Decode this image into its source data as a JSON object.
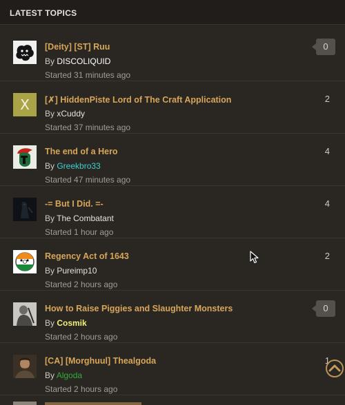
{
  "header": {
    "title": "LATEST TOPICS"
  },
  "topics": [
    {
      "title": "[Deity] [ST] Ruu",
      "by": "By ",
      "author": "DISCOLIQUID",
      "author_color": "#ffffff",
      "started": "Started 31 minutes ago",
      "count": "0",
      "bubble": true,
      "avatar": "ink-blot-avatar"
    },
    {
      "title": "[✗] HiddenPiste Lord of The Craft Application",
      "by": "By ",
      "author": "xCuddy",
      "author_color": "#e6e1da",
      "started": "Started 37 minutes ago",
      "count": "2",
      "bubble": false,
      "avatar": "letter-x-avatar",
      "avatar_letter": "X"
    },
    {
      "title": "The end of a Hero",
      "by": "By ",
      "author": "Greekbro33",
      "author_color": "#39d3d3",
      "started": "Started 47 minutes ago",
      "count": "4",
      "bubble": false,
      "avatar": "spartan-helmet-avatar"
    },
    {
      "title": "-= But I Did. =-",
      "by": "By ",
      "author": "The Combatant",
      "author_color": "#e6e1da",
      "started": "Started 1 hour ago",
      "count": "4",
      "bubble": false,
      "avatar": "dark-figure-avatar"
    },
    {
      "title": "Regency Act of 1643",
      "by": "By ",
      "author": "Pureimp10",
      "author_color": "#e6e1da",
      "started": "Started 2 hours ago",
      "count": "2",
      "bubble": false,
      "avatar": "flag-ball-avatar"
    },
    {
      "title": "How to Raise Piggies and Slaughter Monsters",
      "by": "By ",
      "author": "Cosmik",
      "author_color": "#f2f07a",
      "started": "Started 2 hours ago",
      "count": "0",
      "bubble": true,
      "avatar": "warrior-avatar"
    },
    {
      "title": "[CA] [Morghuul] Thealgoda",
      "by": "By ",
      "author": "Algoda",
      "author_color": "#2fae3a",
      "started": "Started 2 hours ago",
      "count": "1",
      "bubble": false,
      "avatar": "bearded-man-avatar"
    }
  ],
  "colors": {
    "title": "#d7a65a",
    "background": "#2a2622",
    "accent": "#b8935a"
  },
  "icons": {
    "scroll_top": "chevron-up-icon",
    "cursor": "mouse-pointer-icon"
  }
}
